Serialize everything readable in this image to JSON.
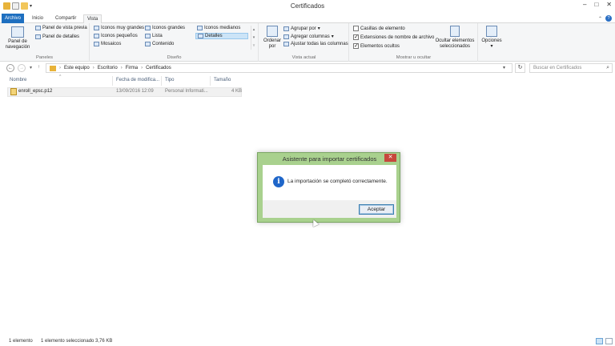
{
  "window": {
    "title": "Certificados",
    "buttons": {
      "minimize": "–",
      "maximize": "□",
      "close": "✕"
    }
  },
  "tabs": [
    {
      "label": "Archivo"
    },
    {
      "label": "Inicio"
    },
    {
      "label": "Compartir"
    },
    {
      "label": "Vista"
    }
  ],
  "ribbon": {
    "panes": {
      "navigation_pane": "Panel de navegación",
      "preview_pane": "Panel de vista previa",
      "details_pane": "Panel de detalles",
      "group_label": "Paneles"
    },
    "layout": {
      "items": [
        "Iconos muy grandes",
        "Iconos grandes",
        "Iconos medianos",
        "Iconos pequeños",
        "Lista",
        "Detalles",
        "Mosaicos",
        "Contenido"
      ],
      "selected": "Detalles",
      "group_label": "Diseño"
    },
    "current_view": {
      "sort_by": "Ordenar por",
      "group_by": "Agrupar por",
      "add_columns": "Agregar columnas",
      "fit_columns": "Ajustar todas las columnas",
      "group_label": "Vista actual"
    },
    "show_hide": {
      "item_checkboxes": {
        "label": "Casillas de elemento",
        "checked": false
      },
      "file_extensions": {
        "label": "Extensiones de nombre de archivo",
        "checked": true
      },
      "hidden_items": {
        "label": "Elementos ocultos",
        "checked": true
      },
      "hide_selected": "Ocultar elementos seleccionados",
      "group_label": "Mostrar u ocultar"
    },
    "options": "Opciones"
  },
  "address": {
    "path": [
      "Este equipo",
      "Escritorio",
      "Firma",
      "Certificados"
    ],
    "search_placeholder": "Buscar en Certificados"
  },
  "columns": [
    "Nombre",
    "Fecha de modifica...",
    "Tipo",
    "Tamaño"
  ],
  "files": [
    {
      "name": "enroll_epsc.p12",
      "modified": "13/09/2016 12:09",
      "type": "Personal Informati...",
      "size": "4 KB"
    }
  ],
  "dialog": {
    "title": "Asistente para importar certificados",
    "message": "La importación se completó correctamente.",
    "ok_label": "Aceptar",
    "close_glyph": "✕",
    "info_glyph": "i"
  },
  "status": {
    "item_count": "1 elemento",
    "selection": "1 elemento seleccionado  3,76 KB"
  }
}
